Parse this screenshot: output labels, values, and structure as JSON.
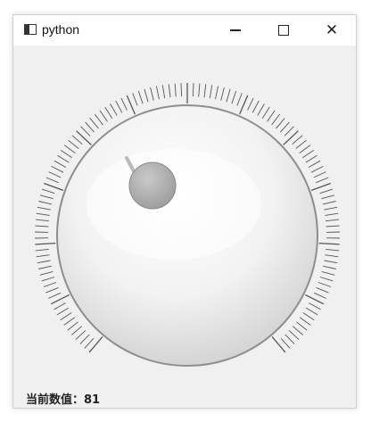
{
  "window": {
    "title": "python"
  },
  "status": {
    "label": "当前数值：",
    "value": "81"
  },
  "dial": {
    "value": 81,
    "min": 0,
    "max": 100
  }
}
